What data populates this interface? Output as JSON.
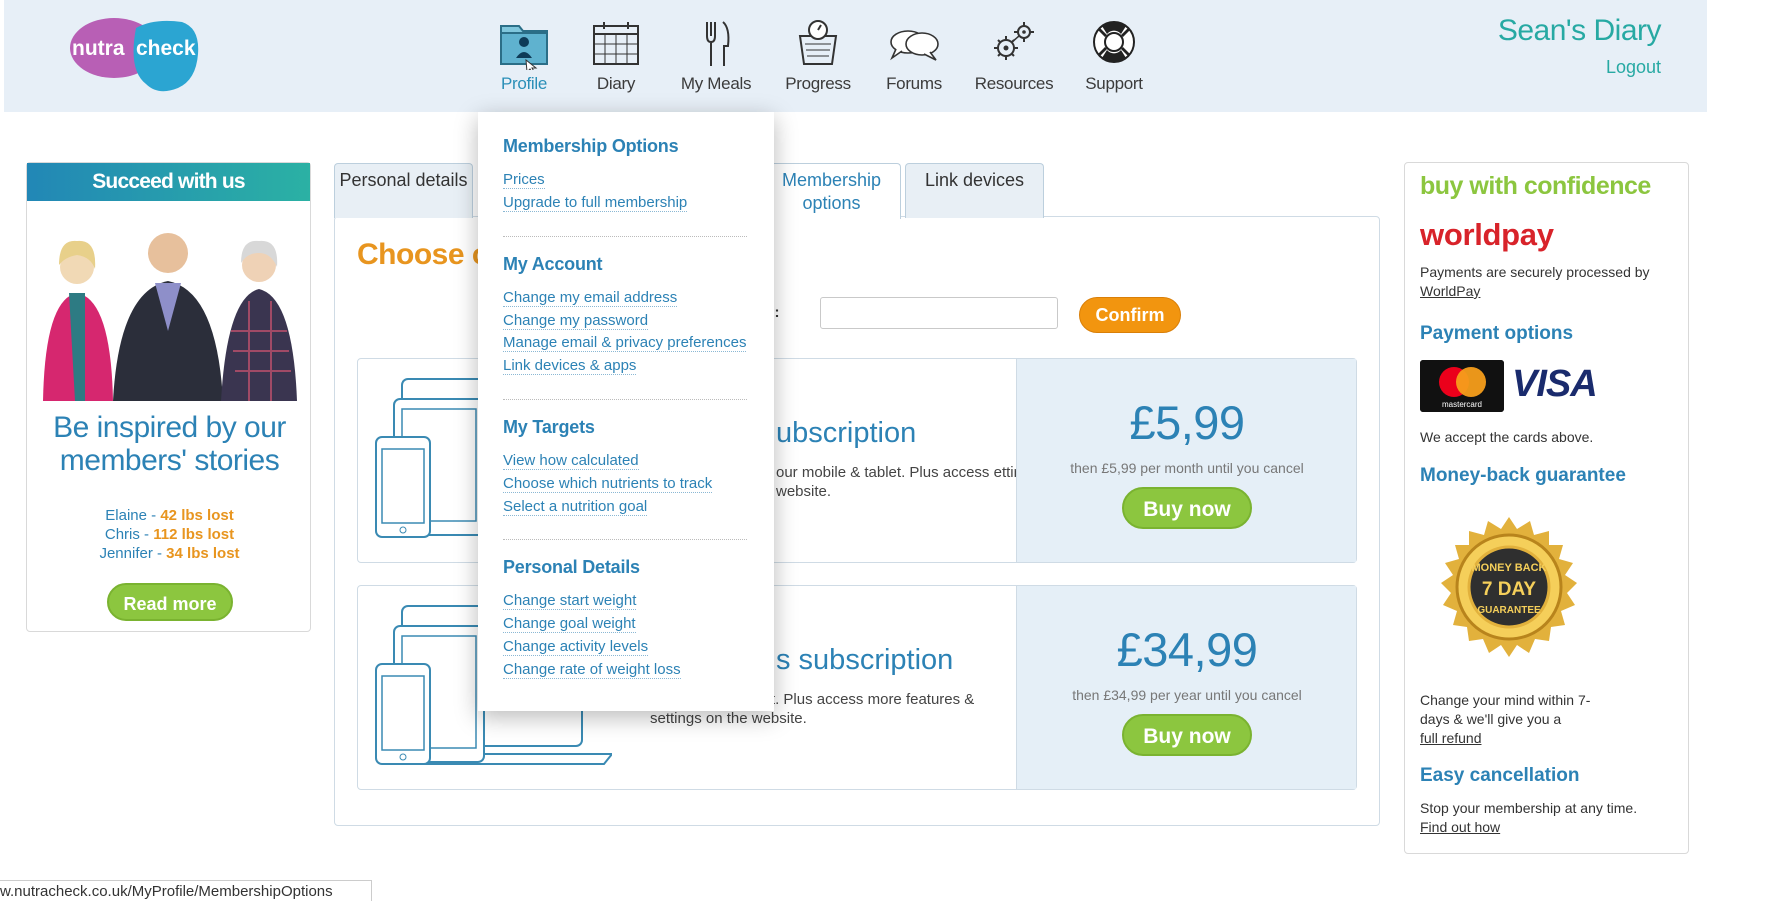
{
  "header": {
    "logo_left": "nutra",
    "logo_right": "check",
    "nav": [
      {
        "label": "Profile",
        "icon": "profile-folder-icon"
      },
      {
        "label": "Diary",
        "icon": "calendar-icon"
      },
      {
        "label": "My Meals",
        "icon": "fork-knife-icon"
      },
      {
        "label": "Progress",
        "icon": "scale-icon"
      },
      {
        "label": "Forums",
        "icon": "speech-bubbles-icon"
      },
      {
        "label": "Resources",
        "icon": "gears-icon"
      },
      {
        "label": "Support",
        "icon": "lifebuoy-icon"
      }
    ],
    "diary_title": "Sean's Diary",
    "logout": "Logout"
  },
  "left_panel": {
    "heading": "Succeed with us",
    "inspired": "Be inspired by our members' stories",
    "stories": [
      {
        "name": "Elaine",
        "lost": "42 lbs lost"
      },
      {
        "name": "Chris",
        "lost": "112 lbs lost"
      },
      {
        "name": "Jennifer",
        "lost": "34 lbs lost"
      }
    ],
    "read_more": "Read more"
  },
  "tabs": [
    {
      "label": "Personal details"
    },
    {
      "label": "Membership options"
    },
    {
      "label": "Link devices"
    }
  ],
  "main": {
    "title": "Choose o",
    "promo_label": "ere:",
    "promo_value": "",
    "confirm": "Confirm",
    "plans": [
      {
        "title": "ubscription",
        "desc": "our mobile & tablet. Plus access ettings on the website.",
        "price": "£5,99",
        "price_note": "then £5,99 per month until you cancel",
        "buy": "Buy now"
      },
      {
        "title": "s subscription",
        "desc": "our mobile & tablet. Plus access more features & settings on the website.",
        "price": "£34,99",
        "price_note": "then £34,99 per year until you cancel",
        "buy": "Buy now"
      }
    ]
  },
  "dropdown": {
    "sections": [
      {
        "heading": "Membership Options",
        "links": [
          "Prices",
          "Upgrade to full membership"
        ]
      },
      {
        "heading": "My Account",
        "links": [
          "Change my email address",
          "Change my password",
          "Manage email & privacy preferences",
          "Link devices & apps"
        ]
      },
      {
        "heading": "My Targets",
        "links": [
          "View how calculated",
          "Choose which nutrients to track",
          "Select a nutrition goal"
        ]
      },
      {
        "heading": "Personal Details",
        "links": [
          "Change start weight",
          "Change goal weight",
          "Change activity levels",
          "Change rate of weight loss"
        ]
      }
    ]
  },
  "right_panel": {
    "confidence": "buy with confidence",
    "worldpay": "worldpay",
    "secure_text": "Payments are securely processed by",
    "worldpay_link": "WorldPay",
    "payment_heading": "Payment options",
    "mastercard_label": "mastercard",
    "visa": "VISA",
    "accept_text": "We accept the cards above.",
    "moneyback_heading": "Money-back guarantee",
    "seal_top": "MONEY BACK",
    "seal_mid": "7 DAY",
    "seal_bottom": "GUARANTEE",
    "change_text": "Change your mind within 7-days & we'll give you a",
    "refund_link": "full refund",
    "cancel_heading": "Easy cancellation",
    "cancel_text": "Stop your membership at any time.",
    "findout_link": "Find out how"
  },
  "statusbar": {
    "url": "w.nutracheck.co.uk/MyProfile/MembershipOptions"
  },
  "colors": {
    "brand_blue": "#2c82b5",
    "teal": "#27a9a3",
    "green": "#8cc63f",
    "orange": "#f2950f",
    "header_bg": "#e7eff7"
  }
}
